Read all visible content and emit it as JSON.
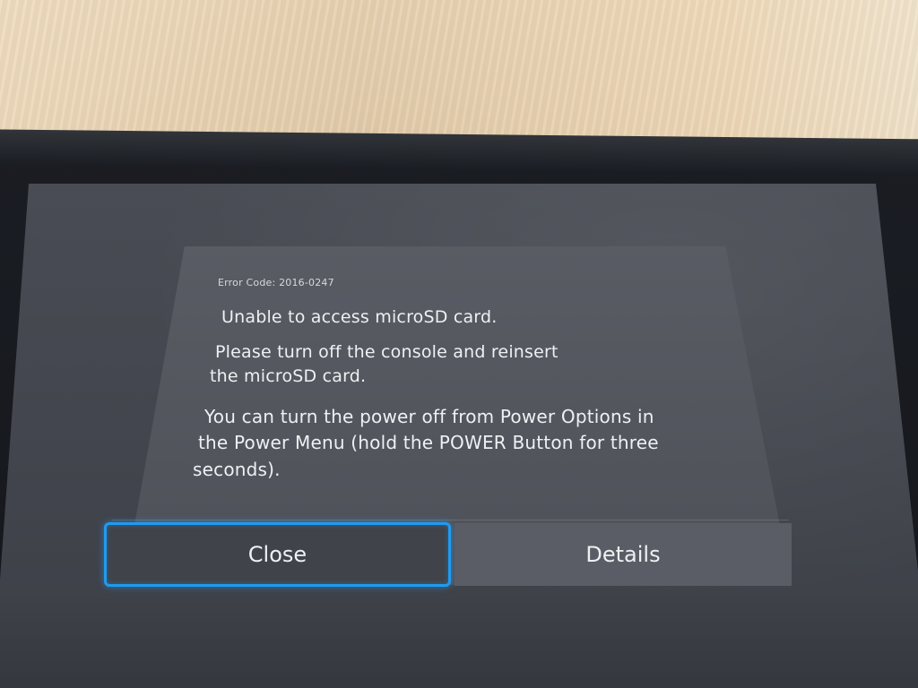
{
  "dialog": {
    "error_code": "Error Code: 2016-0247",
    "message_title": "Unable to access microSD card.",
    "message_body_line1": "Please turn off the console and reinsert",
    "message_body_line2": "the microSD card.",
    "message_help_line1": "You can turn the power off from Power Options in",
    "message_help_line2": "the Power Menu (hold the POWER Button for three",
    "message_help_line3": "seconds).",
    "buttons": {
      "close_label": "Close",
      "details_label": "Details"
    }
  },
  "colors": {
    "focus_highlight": "#1f9bf0",
    "dialog_background": "#52555d",
    "text": "#eef0f3"
  }
}
